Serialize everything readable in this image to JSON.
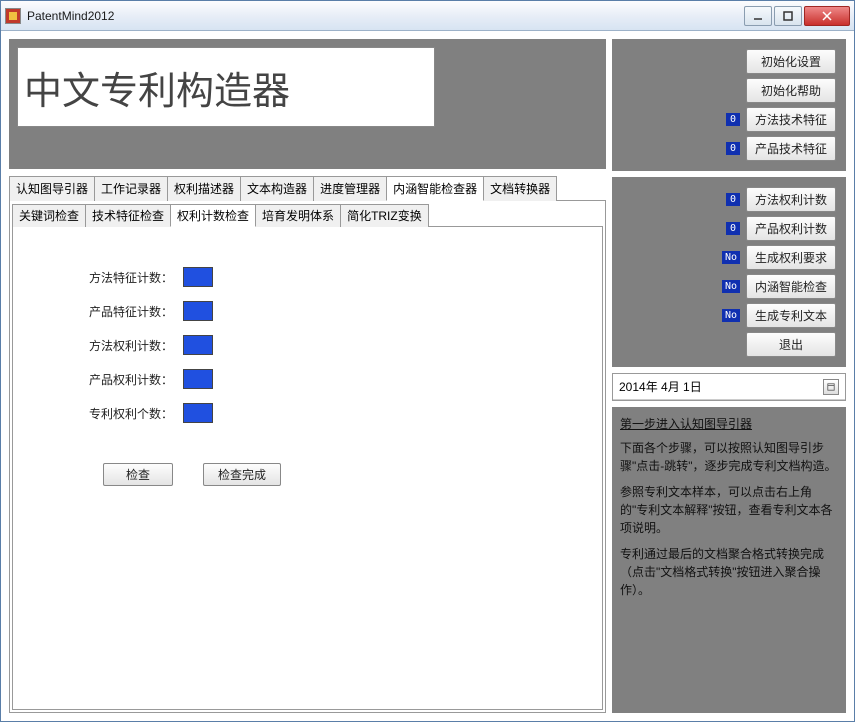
{
  "window": {
    "title": "PatentMind2012"
  },
  "header": {
    "title": "中文专利构造器"
  },
  "main_tabs": [
    {
      "label": "认知图导引器"
    },
    {
      "label": "工作记录器"
    },
    {
      "label": "权利描述器"
    },
    {
      "label": "文本构造器"
    },
    {
      "label": "进度管理器"
    },
    {
      "label": "内涵智能检查器"
    },
    {
      "label": "文档转换器"
    }
  ],
  "sub_tabs": [
    {
      "label": "关键词检查"
    },
    {
      "label": "技术特征检查"
    },
    {
      "label": "权利计数检查"
    },
    {
      "label": "培育发明体系"
    },
    {
      "label": "简化TRIZ变换"
    }
  ],
  "counts": [
    {
      "label": "方法特征计数："
    },
    {
      "label": "产品特征计数："
    },
    {
      "label": "方法权利计数："
    },
    {
      "label": "产品权利计数："
    },
    {
      "label": "专利权利个数："
    }
  ],
  "actions": {
    "check": "检查",
    "check_done": "检查完成"
  },
  "side_top": {
    "init_settings": "初始化设置",
    "init_help": "初始化帮助",
    "method_feature": "方法技术特征",
    "product_feature": "产品技术特征",
    "badge_0": "0"
  },
  "side_mid": {
    "method_claim": "方法权利计数",
    "product_claim": "产品权利计数",
    "gen_claims": "生成权利要求",
    "smart_check": "内涵智能检查",
    "gen_patent": "生成专利文本",
    "exit": "退出",
    "badge_0": "0",
    "badge_no": "No"
  },
  "date": {
    "value": "2014年 4月 1日"
  },
  "help": {
    "header": "第一步进入认知图导引器",
    "p1": "下面各个步骤，可以按照认知图导引步骤\"点击-跳转\"，逐步完成专利文档构造。",
    "p2": "参照专利文本样本，可以点击右上角的\"专利文本解释\"按钮，查看专利文本各项说明。",
    "p3": "专利通过最后的文档聚合格式转换完成（点击\"文档格式转换\"按钮进入聚合操作）。"
  }
}
